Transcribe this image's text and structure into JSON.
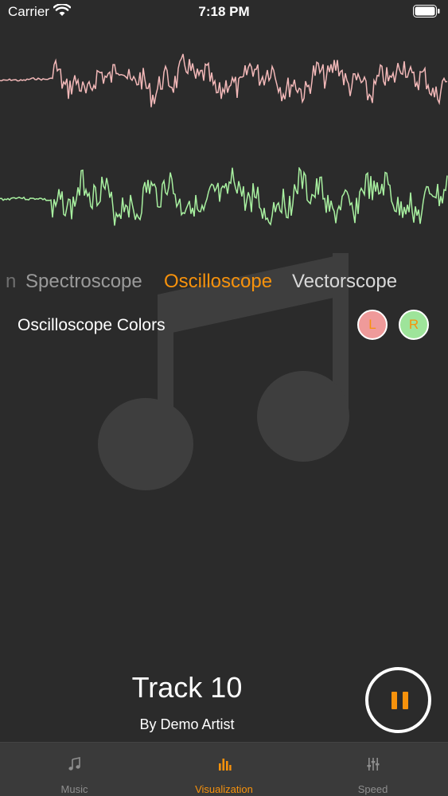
{
  "status_bar": {
    "carrier": "Carrier",
    "time": "7:18 PM"
  },
  "colors": {
    "accent": "#f7920c",
    "background": "#2b2b2b",
    "wave_left": "#f2b8b8",
    "wave_right": "#a8f0a0",
    "tab_bar": "#3a3a3a"
  },
  "modes": {
    "items": [
      "n",
      "Spectroscope",
      "Oscilloscope",
      "Vectorscope"
    ],
    "selected": "Oscilloscope"
  },
  "oscilloscope_colors": {
    "label": "Oscilloscope Colors",
    "left_label": "L",
    "right_label": "R"
  },
  "track": {
    "title": "Track 10",
    "artist": "By Demo Artist"
  },
  "tabs": [
    {
      "label": "Music",
      "icon": "music-note-icon"
    },
    {
      "label": "Visualization",
      "icon": "bar-chart-icon"
    },
    {
      "label": "Speed",
      "icon": "sliders-icon"
    }
  ],
  "selected_tab": "Visualization"
}
